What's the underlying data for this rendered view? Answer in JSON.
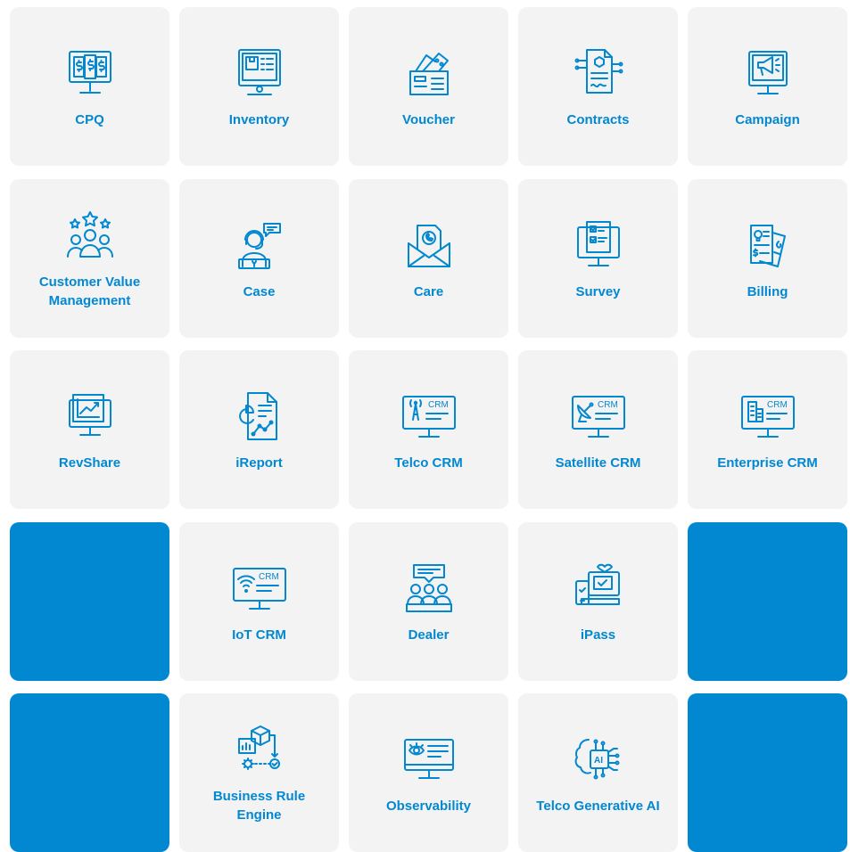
{
  "colors": {
    "tile_bg": "#f3f3f3",
    "accent": "#0288d1",
    "blank_tile": "#0288d1"
  },
  "tiles": [
    {
      "label": "CPQ",
      "icon": "monitor-dollar-icon"
    },
    {
      "label": "Inventory",
      "icon": "monitor-inventory-icon"
    },
    {
      "label": "Voucher",
      "icon": "envelope-voucher-icon"
    },
    {
      "label": "Contracts",
      "icon": "contract-document-icon"
    },
    {
      "label": "Campaign",
      "icon": "megaphone-monitor-icon"
    },
    {
      "label": "Customer Value Management",
      "icon": "customers-stars-icon"
    },
    {
      "label": "Case",
      "icon": "support-agent-icon"
    },
    {
      "label": "Care",
      "icon": "envelope-phone-icon"
    },
    {
      "label": "Survey",
      "icon": "monitor-checklist-icon"
    },
    {
      "label": "Billing",
      "icon": "invoice-icon"
    },
    {
      "label": "RevShare",
      "icon": "monitor-chart-icon"
    },
    {
      "label": "iReport",
      "icon": "report-document-icon"
    },
    {
      "label": "Telco CRM",
      "icon": "monitor-tower-icon",
      "icon_text": "CRM"
    },
    {
      "label": "Satellite CRM",
      "icon": "monitor-satellite-icon",
      "icon_text": "CRM"
    },
    {
      "label": "Enterprise CRM",
      "icon": "monitor-building-icon",
      "icon_text": "CRM"
    },
    {
      "label": "IoT CRM",
      "icon": "monitor-wifi-icon",
      "icon_text": "CRM"
    },
    {
      "label": "Dealer",
      "icon": "dealer-group-icon"
    },
    {
      "label": "iPass",
      "icon": "devices-icon"
    },
    {
      "label": "Business Rule Engine",
      "icon": "rule-engine-icon"
    },
    {
      "label": "Observability",
      "icon": "monitor-eye-icon"
    },
    {
      "label": "Telco Generative AI",
      "icon": "ai-chip-icon",
      "icon_text": "AI"
    }
  ]
}
